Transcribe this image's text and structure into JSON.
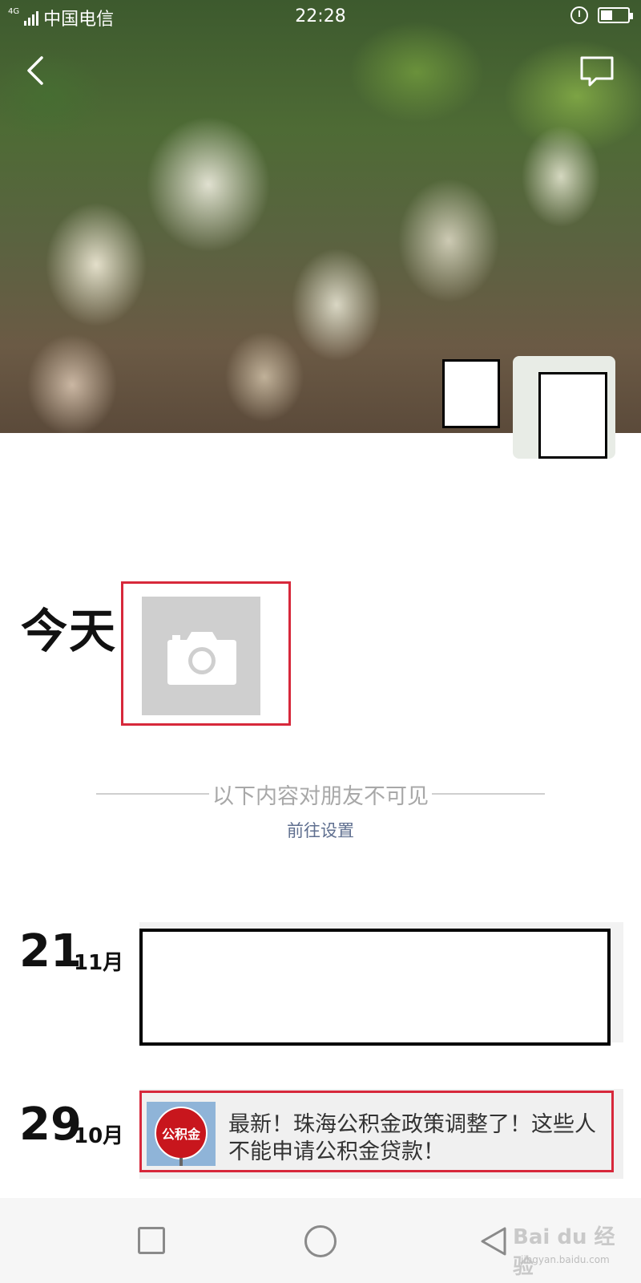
{
  "status_bar": {
    "network": "4G",
    "carrier": "中国电信",
    "time": "22:28",
    "battery_level": 0.45
  },
  "today": {
    "label": "今天"
  },
  "privacy_divider": {
    "text": "以下内容对朋友不可见",
    "link": "前往设置"
  },
  "posts": [
    {
      "day": "21",
      "month": "11月"
    },
    {
      "day": "29",
      "month": "10月",
      "thumb_text": "公积金",
      "title": "最新！珠海公积金政策调整了！这些人不能申请公积金贷款！"
    }
  ],
  "watermark": {
    "logo": "Bai du 经验",
    "url": "jingyan.baidu.com"
  },
  "colors": {
    "highlight": "#d7283b",
    "link": "#5f6f8f"
  }
}
